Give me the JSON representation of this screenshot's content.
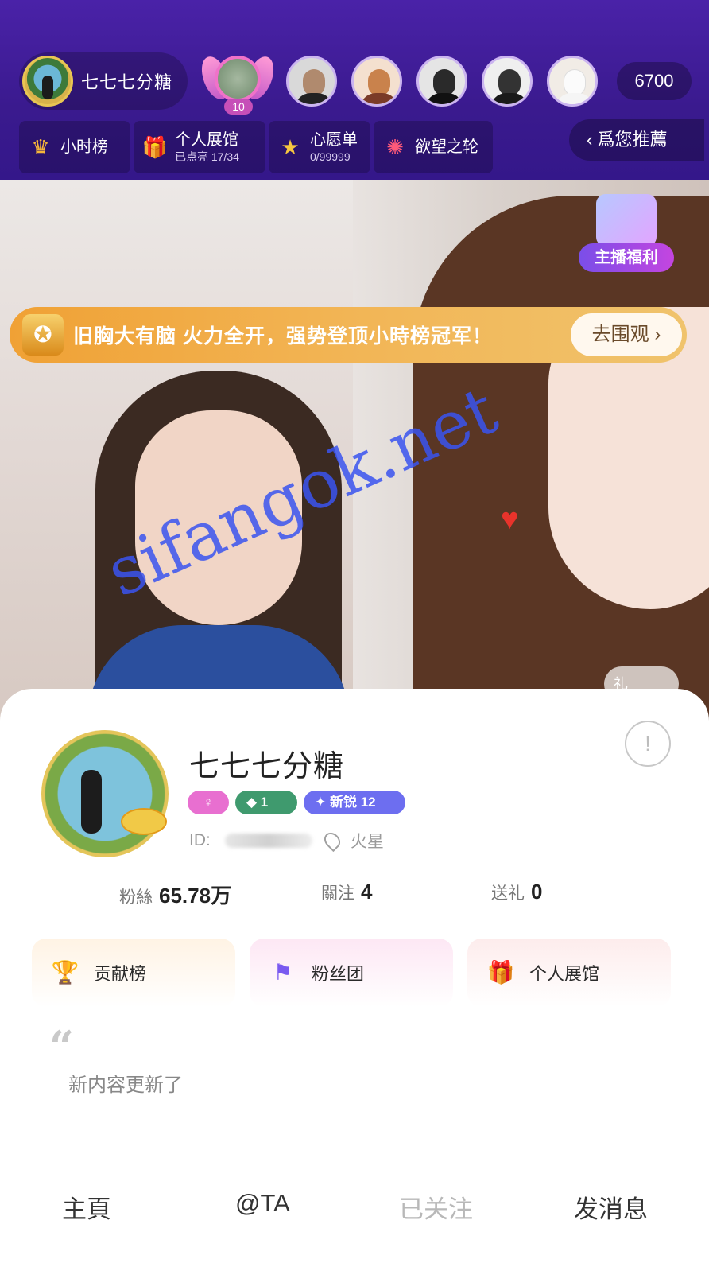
{
  "header": {
    "host_name": "七七七分糖",
    "crown_level": "10",
    "viewer_count": "6700",
    "viewers": [
      "viewer-1",
      "viewer-2",
      "viewer-3",
      "viewer-4",
      "viewer-5"
    ]
  },
  "tools": [
    {
      "label": "小时榜",
      "sub": "",
      "icon": "crown-icon"
    },
    {
      "label": "个人展馆",
      "sub": "已点亮 17/34",
      "icon": "gift-box-icon"
    },
    {
      "label": "心愿单",
      "sub": "0/99999",
      "icon": "star-icon"
    },
    {
      "label": "欲望之轮",
      "sub": "",
      "icon": "wheel-icon"
    }
  ],
  "recommend": {
    "label": "爲您推薦",
    "icon": "chevron-left-icon"
  },
  "stream": {
    "gift_badge_label": "主播福利",
    "banner_text": "旧胸大有脑 火力全开，强势登顶小時榜冠军！",
    "banner_button": "去围观",
    "gift_tab_label": "礼"
  },
  "watermark": "sifangok.net",
  "profile": {
    "name": "七七七分糖",
    "badges": [
      {
        "text": "",
        "icon": "female-icon",
        "color": "#e86fd0"
      },
      {
        "text": "1",
        "icon": "level-icon",
        "color": "#3f9a6e"
      },
      {
        "text": "新锐 12",
        "icon": "rank-icon",
        "color": "#6d6ef0"
      }
    ],
    "id_label": "ID:",
    "location": "火星",
    "stats": [
      {
        "label": "粉絲",
        "value": "65.78万"
      },
      {
        "label": "關注",
        "value": "4"
      },
      {
        "label": "送礼",
        "value": "0"
      }
    ],
    "quick_links": [
      {
        "label": "贡献榜",
        "icon": "trophy-icon",
        "bg": "#fff4e6"
      },
      {
        "label": "粉丝团",
        "icon": "flag-icon",
        "bg": "#fdebf5"
      },
      {
        "label": "个人展馆",
        "icon": "gift-icon",
        "bg": "#fdf0f0"
      }
    ],
    "bio": "新内容更新了"
  },
  "bottom_nav": [
    {
      "label": "主頁",
      "color": "#333333"
    },
    {
      "label": "@TA",
      "color": "#333333"
    },
    {
      "label": "已关注",
      "color": "#b8b8b8"
    },
    {
      "label": "发消息",
      "color": "#333333"
    }
  ]
}
